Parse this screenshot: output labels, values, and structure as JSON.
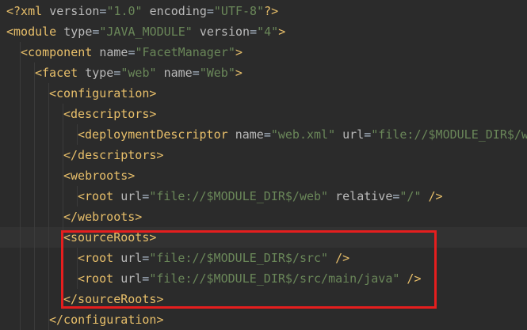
{
  "editor": {
    "language": "xml",
    "colors": {
      "background": "#2b2b2b",
      "current_line": "#323232",
      "tag": "#e8bf6a",
      "attribute": "#bababa",
      "value": "#6a8759",
      "plain": "#a9b7c6",
      "highlight_box": "#e51e1e"
    },
    "lines": [
      {
        "indent": 0,
        "tokens": [
          {
            "t": "pi",
            "v": "<?xml "
          },
          {
            "t": "attr",
            "v": "version"
          },
          {
            "t": "plain",
            "v": "="
          },
          {
            "t": "value",
            "v": "\"1.0\""
          },
          {
            "t": "plain",
            "v": " "
          },
          {
            "t": "attr",
            "v": "encoding"
          },
          {
            "t": "plain",
            "v": "="
          },
          {
            "t": "value",
            "v": "\"UTF-8\""
          },
          {
            "t": "pi",
            "v": "?>"
          }
        ]
      },
      {
        "indent": 0,
        "tokens": [
          {
            "t": "tag",
            "v": "<module "
          },
          {
            "t": "attr",
            "v": "type"
          },
          {
            "t": "plain",
            "v": "="
          },
          {
            "t": "value",
            "v": "\"JAVA_MODULE\""
          },
          {
            "t": "plain",
            "v": " "
          },
          {
            "t": "attr",
            "v": "version"
          },
          {
            "t": "plain",
            "v": "="
          },
          {
            "t": "value",
            "v": "\"4\""
          },
          {
            "t": "tag",
            "v": ">"
          }
        ]
      },
      {
        "indent": 1,
        "tokens": [
          {
            "t": "tag",
            "v": "<component "
          },
          {
            "t": "attr",
            "v": "name"
          },
          {
            "t": "plain",
            "v": "="
          },
          {
            "t": "value",
            "v": "\"FacetManager\""
          },
          {
            "t": "tag",
            "v": ">"
          }
        ]
      },
      {
        "indent": 2,
        "tokens": [
          {
            "t": "tag",
            "v": "<facet "
          },
          {
            "t": "attr",
            "v": "type"
          },
          {
            "t": "plain",
            "v": "="
          },
          {
            "t": "value",
            "v": "\"web\""
          },
          {
            "t": "plain",
            "v": " "
          },
          {
            "t": "attr",
            "v": "name"
          },
          {
            "t": "plain",
            "v": "="
          },
          {
            "t": "value",
            "v": "\"Web\""
          },
          {
            "t": "tag",
            "v": ">"
          }
        ]
      },
      {
        "indent": 3,
        "tokens": [
          {
            "t": "tag",
            "v": "<configuration>"
          }
        ]
      },
      {
        "indent": 4,
        "tokens": [
          {
            "t": "tag",
            "v": "<descriptors>"
          }
        ]
      },
      {
        "indent": 5,
        "tokens": [
          {
            "t": "tag",
            "v": "<deploymentDescriptor "
          },
          {
            "t": "attr",
            "v": "name"
          },
          {
            "t": "plain",
            "v": "="
          },
          {
            "t": "value",
            "v": "\"web.xml\""
          },
          {
            "t": "plain",
            "v": " "
          },
          {
            "t": "attr",
            "v": "url"
          },
          {
            "t": "plain",
            "v": "="
          },
          {
            "t": "value",
            "v": "\"file://$MODULE_DIR$/w"
          }
        ]
      },
      {
        "indent": 4,
        "tokens": [
          {
            "t": "tag",
            "v": "</descriptors>"
          }
        ]
      },
      {
        "indent": 4,
        "tokens": [
          {
            "t": "tag",
            "v": "<webroots>"
          }
        ]
      },
      {
        "indent": 5,
        "tokens": [
          {
            "t": "tag",
            "v": "<root "
          },
          {
            "t": "attr",
            "v": "url"
          },
          {
            "t": "plain",
            "v": "="
          },
          {
            "t": "value",
            "v": "\"file://$MODULE_DIR$/web\""
          },
          {
            "t": "plain",
            "v": " "
          },
          {
            "t": "attr",
            "v": "relative"
          },
          {
            "t": "plain",
            "v": "="
          },
          {
            "t": "value",
            "v": "\"/\""
          },
          {
            "t": "tag",
            "v": " />"
          }
        ]
      },
      {
        "indent": 4,
        "tokens": [
          {
            "t": "tag",
            "v": "</webroots>"
          }
        ]
      },
      {
        "indent": 4,
        "current": true,
        "tokens": [
          {
            "t": "tag",
            "v": "<sourceRoots>"
          }
        ]
      },
      {
        "indent": 5,
        "tokens": [
          {
            "t": "tag",
            "v": "<root "
          },
          {
            "t": "attr",
            "v": "url"
          },
          {
            "t": "plain",
            "v": "="
          },
          {
            "t": "value",
            "v": "\"file://$MODULE_DIR$/src\""
          },
          {
            "t": "tag",
            "v": " />"
          }
        ]
      },
      {
        "indent": 5,
        "tokens": [
          {
            "t": "tag",
            "v": "<root "
          },
          {
            "t": "attr",
            "v": "url"
          },
          {
            "t": "plain",
            "v": "="
          },
          {
            "t": "value",
            "v": "\"file://$MODULE_DIR$/src/main/java\""
          },
          {
            "t": "tag",
            "v": " />"
          }
        ]
      },
      {
        "indent": 4,
        "tokens": [
          {
            "t": "tag",
            "v": "</sourceRoots>"
          }
        ]
      },
      {
        "indent": 3,
        "tokens": [
          {
            "t": "tag",
            "v": "</configuration>"
          }
        ]
      }
    ]
  }
}
